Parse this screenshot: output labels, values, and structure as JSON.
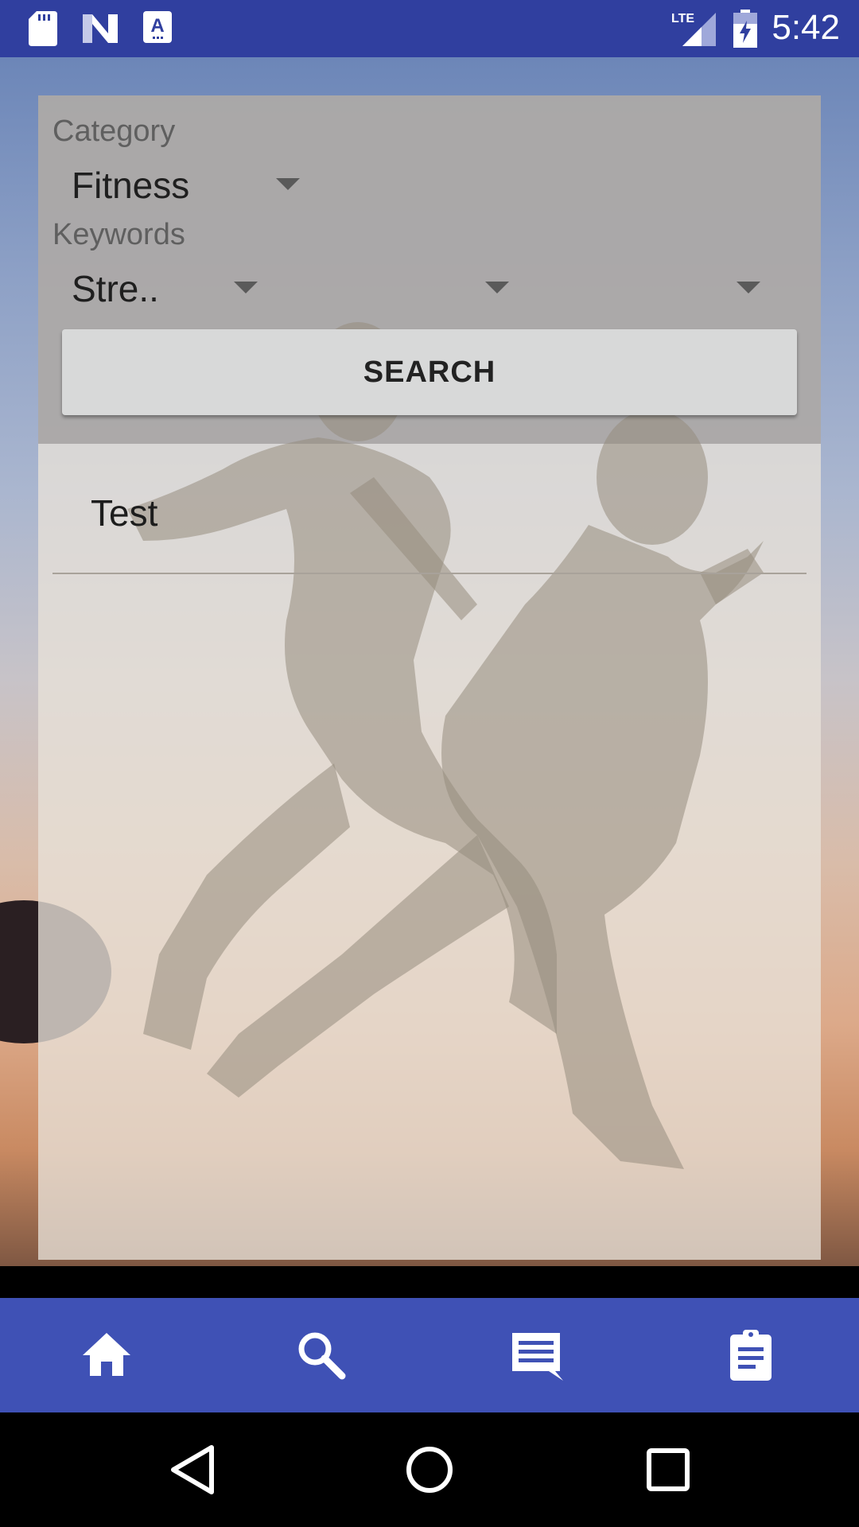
{
  "status_bar": {
    "time": "5:42",
    "network_label": "LTE",
    "icons": [
      "sd-card-icon",
      "n-notification-icon",
      "a-notification-icon",
      "signal-icon",
      "battery-charging-icon"
    ]
  },
  "form": {
    "category_label": "Category",
    "category_value": "Fitness",
    "keywords_label": "Keywords",
    "keyword_values": [
      "Stre..",
      "",
      ""
    ],
    "search_label": "SEARCH"
  },
  "results": {
    "items": [
      "Test"
    ]
  },
  "bottom_nav": {
    "items": [
      "home-icon",
      "search-icon",
      "message-icon",
      "assignment-icon"
    ]
  },
  "system_nav": {
    "items": [
      "back-icon",
      "home-circle-icon",
      "recents-icon"
    ]
  },
  "colors": {
    "status_bar": "#303F9F",
    "bottom_nav": "#3F51B5"
  }
}
